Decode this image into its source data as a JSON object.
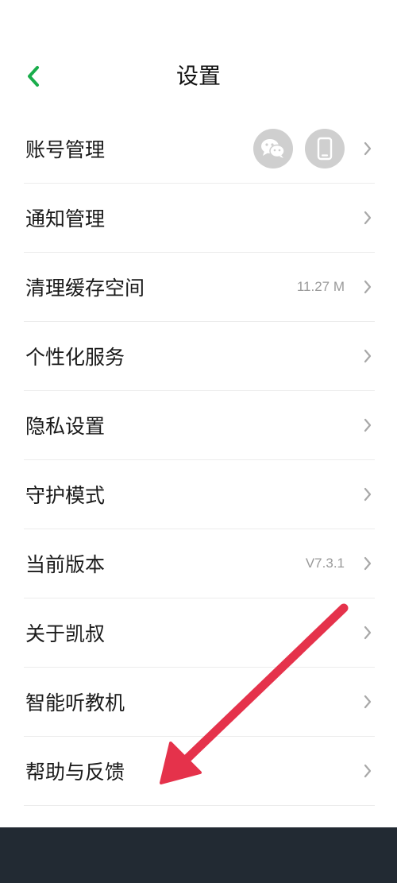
{
  "header": {
    "title": "设置"
  },
  "settings": {
    "items": [
      {
        "label": "账号管理",
        "value": ""
      },
      {
        "label": "通知管理",
        "value": ""
      },
      {
        "label": "清理缓存空间",
        "value": "11.27 M"
      },
      {
        "label": "个性化服务",
        "value": ""
      },
      {
        "label": "隐私设置",
        "value": ""
      },
      {
        "label": "守护模式",
        "value": ""
      },
      {
        "label": "当前版本",
        "value": "V7.3.1"
      },
      {
        "label": "关于凯叔",
        "value": ""
      },
      {
        "label": "智能听教机",
        "value": ""
      },
      {
        "label": "帮助与反馈",
        "value": ""
      }
    ]
  },
  "icons": {
    "back": "chevron-left-icon",
    "account_linked": [
      "wechat-icon",
      "phone-icon"
    ],
    "row_chevron": "chevron-right-icon"
  },
  "colors": {
    "accent": "#1aad4b",
    "annotation_arrow": "#e5324b",
    "bottom_bar": "#222a33"
  }
}
